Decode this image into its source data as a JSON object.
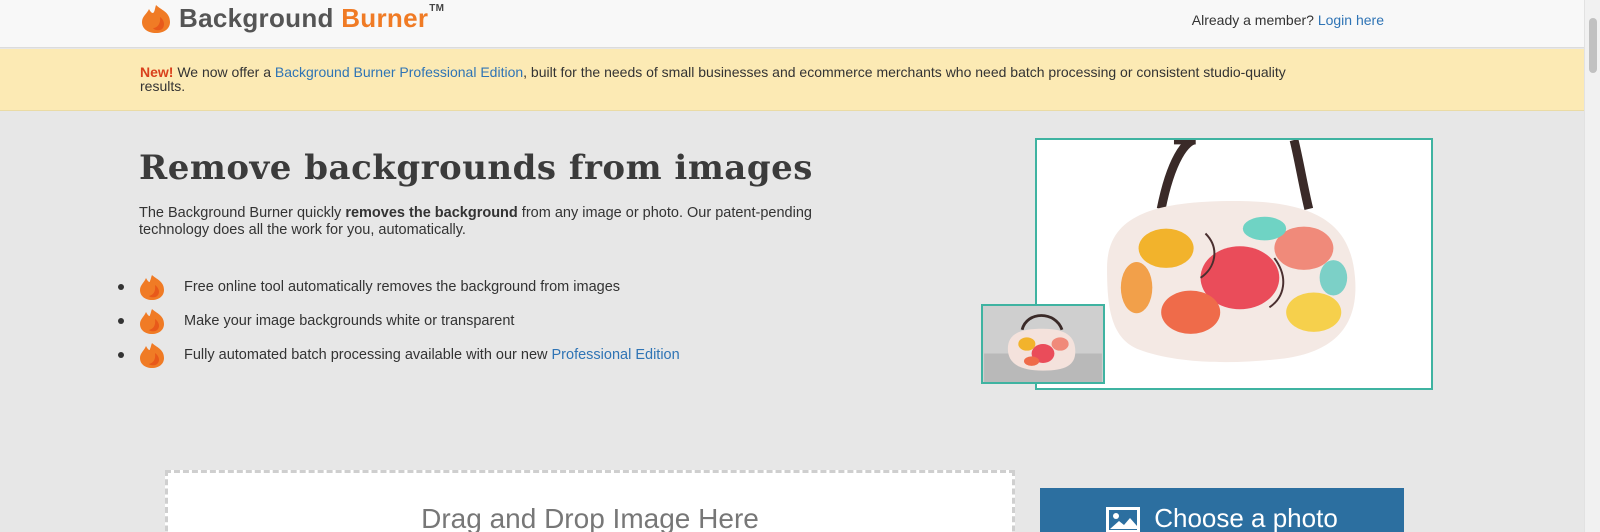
{
  "header": {
    "logo_word1": "Background",
    "logo_word2": "Burner",
    "logo_tm": "TM",
    "member_text": "Already a member?",
    "login_link": "Login here"
  },
  "announcement": {
    "new_label": "New!",
    "text_before": " We now offer a ",
    "link": "Background Burner Professional Edition",
    "text_after": ", built for the needs of small businesses and ecommerce merchants who need batch processing or consistent studio-quality results."
  },
  "hero": {
    "title": "Remove backgrounds from images",
    "desc_before": "The Background Burner quickly ",
    "desc_bold": "removes the background",
    "desc_after": " from any image or photo. Our patent-pending technology does all the work for you, automatically."
  },
  "features": [
    {
      "text": "Free online tool automatically removes the background from images"
    },
    {
      "text": "Make your image backgrounds white or transparent"
    },
    {
      "text": "Fully automated batch processing available with our new",
      "link": "Professional Edition"
    }
  ],
  "upload": {
    "dropzone_label": "Drag and Drop Image Here",
    "choose_button": "Choose a photo"
  },
  "colors": {
    "brand_orange": "#f07b25",
    "link_blue": "#2f74b5",
    "teal_border": "#3fb3a1",
    "button_blue": "#2c6fa0",
    "banner_yellow": "#fceab4"
  }
}
